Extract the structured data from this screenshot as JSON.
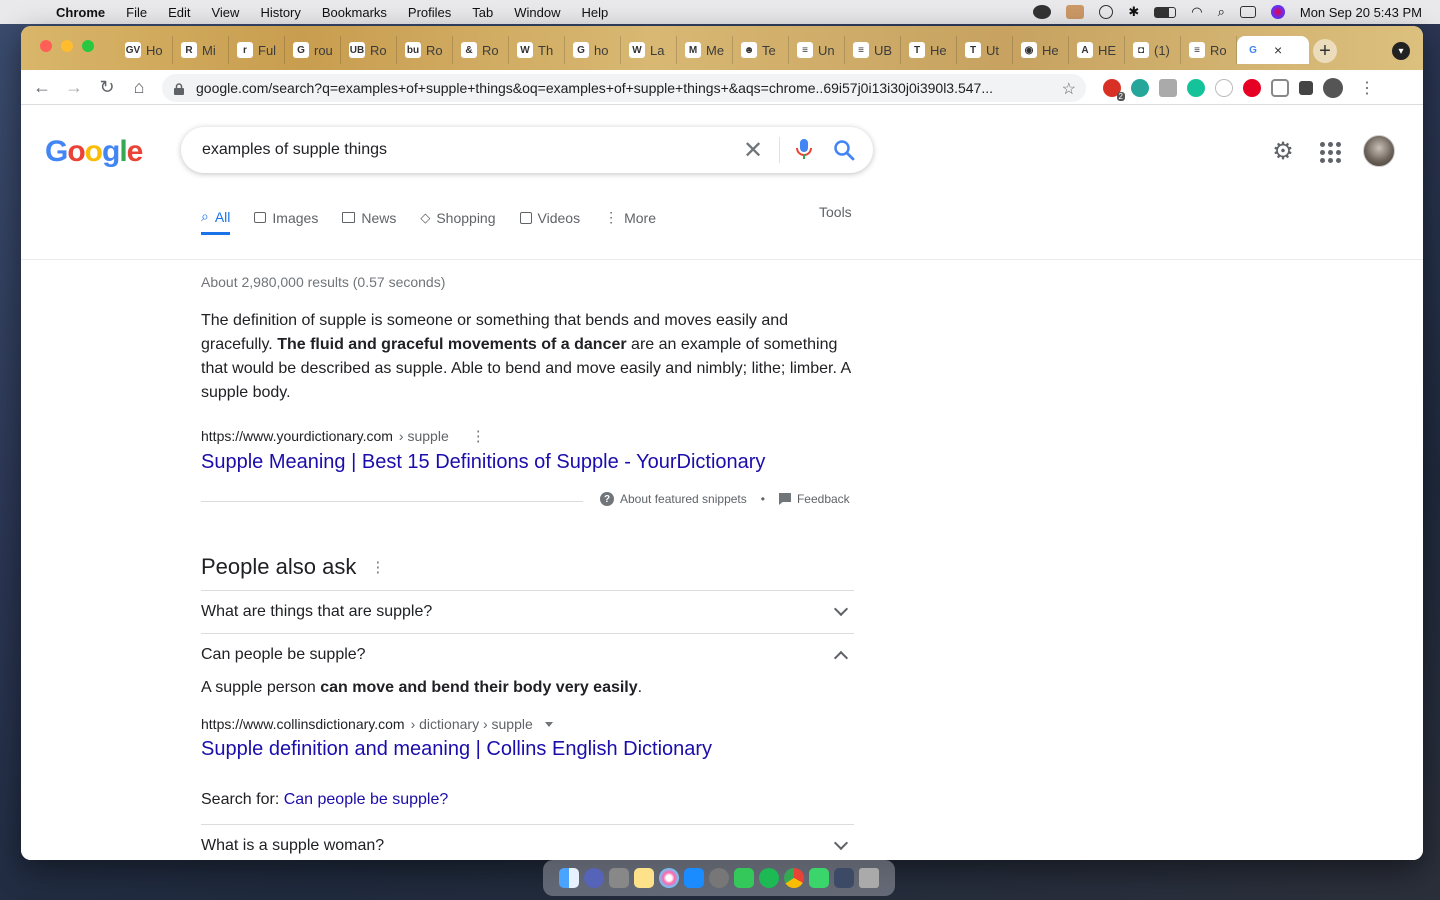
{
  "menubar": {
    "app": "Chrome",
    "items": [
      "File",
      "Edit",
      "View",
      "History",
      "Bookmarks",
      "Profiles",
      "Tab",
      "Window",
      "Help"
    ],
    "clock": "Mon Sep 20  5:43 PM"
  },
  "tabs": [
    {
      "fav": "GV",
      "label": "Ho"
    },
    {
      "fav": "R",
      "label": "Mi"
    },
    {
      "fav": "r",
      "label": "Ful"
    },
    {
      "fav": "G",
      "label": "rou"
    },
    {
      "fav": "UB",
      "label": "Ro"
    },
    {
      "fav": "bu",
      "label": "Ro"
    },
    {
      "fav": "&",
      "label": "Ro"
    },
    {
      "fav": "W",
      "label": "Th"
    },
    {
      "fav": "G",
      "label": "ho"
    },
    {
      "fav": "W",
      "label": "La"
    },
    {
      "fav": "M",
      "label": "Me"
    },
    {
      "fav": "☻",
      "label": "Te"
    },
    {
      "fav": "≡",
      "label": "Un"
    },
    {
      "fav": "≡",
      "label": "UB"
    },
    {
      "fav": "T",
      "label": "He"
    },
    {
      "fav": "T",
      "label": "Ut"
    },
    {
      "fav": "◉",
      "label": "He"
    },
    {
      "fav": "A",
      "label": "HE"
    },
    {
      "fav": "◘",
      "label": "(1)"
    },
    {
      "fav": "≡",
      "label": "Ro"
    }
  ],
  "active_tab": {
    "fav": "G",
    "close": "×"
  },
  "toolbar": {
    "url": "google.com/search?q=examples+of+supple+things&oq=examples+of+supple+things+&aqs=chrome..69i57j0i13i30j0i390l3.547...",
    "ext_badge": "2"
  },
  "google": {
    "logo": [
      "G",
      "o",
      "o",
      "g",
      "l",
      "e"
    ],
    "logo_colors": [
      "#4285F4",
      "#EA4335",
      "#FBBC05",
      "#4285F4",
      "#34A853",
      "#EA4335"
    ],
    "query": "examples of supple things",
    "nav": [
      {
        "label": "All",
        "active": true
      },
      {
        "label": "Images"
      },
      {
        "label": "News"
      },
      {
        "label": "Shopping"
      },
      {
        "label": "Videos"
      },
      {
        "label": "More"
      }
    ],
    "tools": "Tools",
    "results_count": "About 2,980,000 results (0.57 seconds)",
    "snippet": {
      "part1": "The definition of supple is someone or something that bends and moves easily and gracefully. ",
      "bold": "The fluid and graceful movements of a dancer",
      "part2": " are an example of something that would be described as supple. Able to bend and move easily and nimbly; lithe; limber. A supple body."
    },
    "featured_cite": {
      "domain": "https://www.yourdictionary.com",
      "path": " › supple"
    },
    "featured_title": "Supple Meaning | Best 15 Definitions of Supple - YourDictionary",
    "about_snippets": "About featured snippets",
    "dot": "•",
    "feedback": "Feedback",
    "paa_title": "People also ask",
    "paa": [
      {
        "q": "What are things that are supple?"
      },
      {
        "q": "Can people be supple?"
      },
      {
        "q": "What is a supple woman?"
      }
    ],
    "paa_answer": {
      "pre": "A supple person ",
      "bold": "can move and bend their body very easily",
      "post": "."
    },
    "paa_cite": {
      "domain": "https://www.collinsdictionary.com",
      "path": " › dictionary › supple"
    },
    "paa_link": "Supple definition and meaning | Collins English Dictionary",
    "search_for_label": "Search for: ",
    "search_for_link": "Can people be supple?"
  }
}
